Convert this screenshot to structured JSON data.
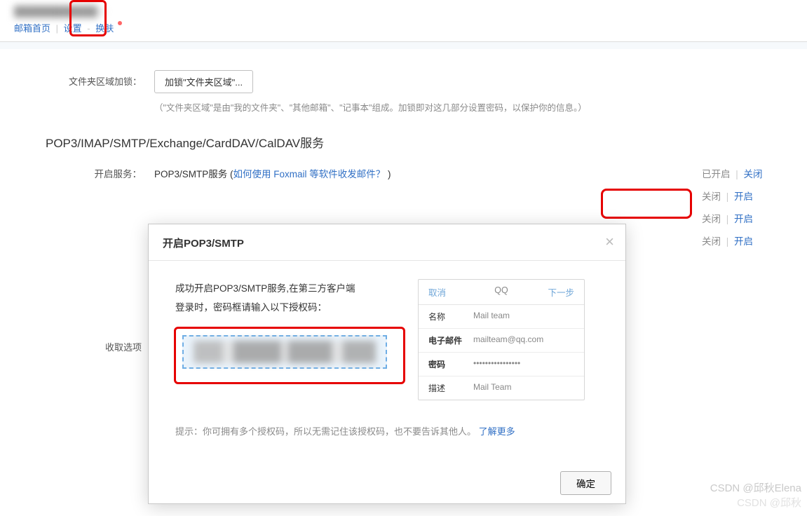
{
  "header": {
    "email_placeholder": "████████████  >",
    "nav": {
      "home": "邮箱首页",
      "settings": "设置",
      "skin": "换肤"
    }
  },
  "lock_section": {
    "label": "文件夹区域加锁：",
    "button": "加锁\"文件夹区域\"...",
    "hint": "（\"文件夹区域\"是由\"我的文件夹\"、\"其他邮箱\"、\"记事本\"组成。加锁即对这几部分设置密码，以保护你的信息。）"
  },
  "services": {
    "title": "POP3/IMAP/SMTP/Exchange/CardDAV/CalDAV服务",
    "enable_label": "开启服务：",
    "rows": [
      {
        "text_prefix": "POP3/SMTP服务 (",
        "link_text": "如何使用 Foxmail 等软件收发邮件？",
        "text_suffix": " )",
        "status": "已开启",
        "action": "关闭"
      },
      {
        "text_prefix": "",
        "link_text": "",
        "text_suffix": "",
        "status": "关闭",
        "action": "开启"
      },
      {
        "text_prefix": "",
        "link_text": "",
        "text_suffix": "",
        "status": "关闭",
        "action": "开启"
      },
      {
        "text_prefix": "",
        "link_text": "",
        "text_suffix": "",
        "status": "关闭",
        "action": "开启"
      }
    ]
  },
  "receive_label": "收取选项",
  "dialog": {
    "title": "开启POP3/SMTP",
    "close_glyph": "×",
    "info_line1": "成功开启POP3/SMTP服务,在第三方客户端",
    "info_line2": "登录时，密码框请输入以下授权码：",
    "mock": {
      "cancel": "取消",
      "title": "QQ",
      "next": "下一步",
      "rows": [
        {
          "k": "名称",
          "v": "Mail team",
          "bold": false
        },
        {
          "k": "电子邮件",
          "v": "mailteam@qq.com",
          "bold": true
        },
        {
          "k": "密码",
          "v": "••••••••••••••••",
          "bold": true
        },
        {
          "k": "描述",
          "v": "Mail Team",
          "bold": false
        }
      ]
    },
    "tip_prefix": "提示：你可拥有多个授权码，所以无需记住该授权码，也不要告诉其他人。",
    "tip_learn": "了解更多",
    "ok": "确定"
  },
  "watermark": {
    "l1": "CSDN @邱秋Elena",
    "l2": "CSDN @邱秋"
  }
}
